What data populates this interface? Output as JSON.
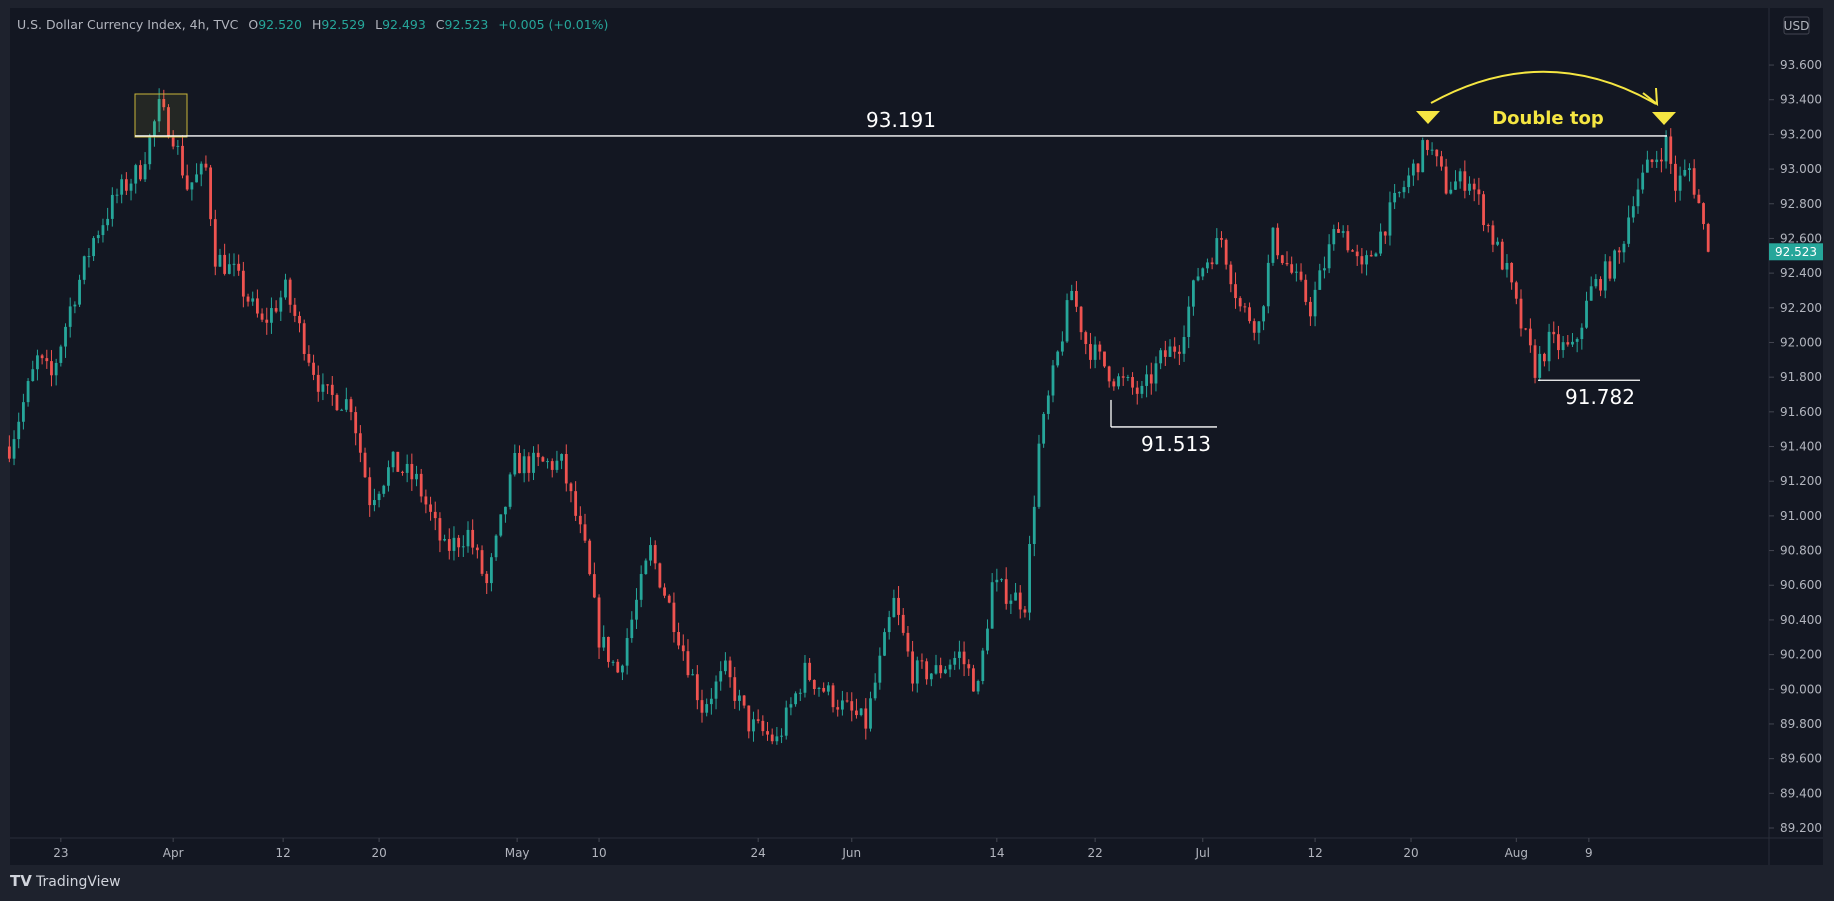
{
  "header": {
    "symbol": "U.S. Dollar Currency Index, 4h, TVC",
    "o_label": "O",
    "o_value": "92.520",
    "h_label": "H",
    "h_value": "92.529",
    "l_label": "L",
    "l_value": "92.493",
    "c_label": "C",
    "c_value": "92.523",
    "change": "+0.005 (+0.01%)"
  },
  "currency_button": "USD",
  "current_price_label": "92.523",
  "footer": {
    "brand": "TradingView"
  },
  "colors": {
    "up": "#26a69a",
    "down": "#ef5350",
    "annotation": "#f5e642",
    "background": "#131722"
  },
  "annotations": {
    "resistance_label": "93.191",
    "support_1_label": "91.513",
    "support_2_label": "91.782",
    "pattern_label": "Double top"
  },
  "chart_data": {
    "type": "candlestick",
    "title": "U.S. Dollar Currency Index, 4h, TVC",
    "ylim": [
      89.1,
      93.75
    ],
    "y_ticks": [
      "93.600",
      "93.400",
      "93.200",
      "93.000",
      "92.800",
      "92.600",
      "92.400",
      "92.200",
      "92.000",
      "91.800",
      "91.600",
      "91.400",
      "91.200",
      "91.000",
      "90.800",
      "90.600",
      "90.400",
      "90.200",
      "90.000",
      "89.800",
      "89.600",
      "89.400",
      "89.200"
    ],
    "x_ticks": [
      {
        "label": "23",
        "bar": 13
      },
      {
        "label": "Apr",
        "bar": 37
      },
      {
        "label": "12",
        "bar": 60.5
      },
      {
        "label": "20",
        "bar": 81
      },
      {
        "label": "May",
        "bar": 110.5
      },
      {
        "label": "10",
        "bar": 128
      },
      {
        "label": "24",
        "bar": 162
      },
      {
        "label": "Jun",
        "bar": 182
      },
      {
        "label": "14",
        "bar": 213
      },
      {
        "label": "22",
        "bar": 234
      },
      {
        "label": "Jul",
        "bar": 257
      },
      {
        "label": "12",
        "bar": 281
      },
      {
        "label": "20",
        "bar": 301.5
      },
      {
        "label": "Aug",
        "bar": 324
      },
      {
        "label": "9",
        "bar": 339.5
      }
    ],
    "price_path": [
      [
        2,
        91.4
      ],
      [
        8,
        91.9
      ],
      [
        11,
        91.8
      ],
      [
        15,
        92.2
      ],
      [
        20,
        92.6
      ],
      [
        25,
        92.85
      ],
      [
        30,
        93.0
      ],
      [
        34,
        93.35
      ],
      [
        37,
        93.2
      ],
      [
        40,
        92.9
      ],
      [
        44,
        93.0
      ],
      [
        46,
        92.5
      ],
      [
        50,
        92.4
      ],
      [
        56,
        92.1
      ],
      [
        61,
        92.3
      ],
      [
        65,
        92.0
      ],
      [
        69,
        91.7
      ],
      [
        75,
        91.65
      ],
      [
        79,
        91.1
      ],
      [
        84,
        91.3
      ],
      [
        89,
        91.2
      ],
      [
        95,
        90.8
      ],
      [
        100,
        90.9
      ],
      [
        104,
        90.6
      ],
      [
        110,
        91.3
      ],
      [
        120,
        91.3
      ],
      [
        125,
        90.8
      ],
      [
        128,
        90.3
      ],
      [
        132,
        90.1
      ],
      [
        139,
        90.8
      ],
      [
        144,
        90.4
      ],
      [
        150,
        89.9
      ],
      [
        155,
        90.1
      ],
      [
        160,
        89.8
      ],
      [
        166,
        89.7
      ],
      [
        172,
        90.1
      ],
      [
        180,
        89.9
      ],
      [
        185,
        89.8
      ],
      [
        191,
        90.5
      ],
      [
        195,
        90.1
      ],
      [
        200,
        90.1
      ],
      [
        205,
        90.2
      ],
      [
        209,
        90.0
      ],
      [
        212,
        90.6
      ],
      [
        219,
        90.5
      ],
      [
        222,
        91.4
      ],
      [
        225,
        91.8
      ],
      [
        229,
        92.3
      ],
      [
        232,
        92.0
      ],
      [
        238,
        91.8
      ],
      [
        244,
        91.7
      ],
      [
        248,
        91.9
      ],
      [
        252,
        92.0
      ],
      [
        256,
        92.4
      ],
      [
        261,
        92.6
      ],
      [
        265,
        92.2
      ],
      [
        269,
        92.1
      ],
      [
        272,
        92.6
      ],
      [
        276,
        92.4
      ],
      [
        280,
        92.2
      ],
      [
        286,
        92.7
      ],
      [
        291,
        92.4
      ],
      [
        298,
        92.8
      ],
      [
        302,
        93.0
      ],
      [
        305,
        93.15
      ],
      [
        309,
        92.9
      ],
      [
        314,
        92.95
      ],
      [
        319,
        92.6
      ],
      [
        322,
        92.4
      ],
      [
        325,
        92.1
      ],
      [
        328,
        91.85
      ],
      [
        331,
        92.0
      ],
      [
        336,
        91.95
      ],
      [
        340,
        92.3
      ],
      [
        346,
        92.5
      ],
      [
        349,
        92.85
      ],
      [
        352,
        93.0
      ],
      [
        356,
        93.15
      ],
      [
        358,
        92.9
      ],
      [
        361,
        93.0
      ],
      [
        363,
        92.8
      ],
      [
        365,
        92.52
      ]
    ],
    "levels": [
      {
        "name": "resistance",
        "price": 93.191
      },
      {
        "name": "support-1",
        "price": 91.513
      },
      {
        "name": "support-2",
        "price": 91.782
      }
    ],
    "last_price": 92.523
  }
}
